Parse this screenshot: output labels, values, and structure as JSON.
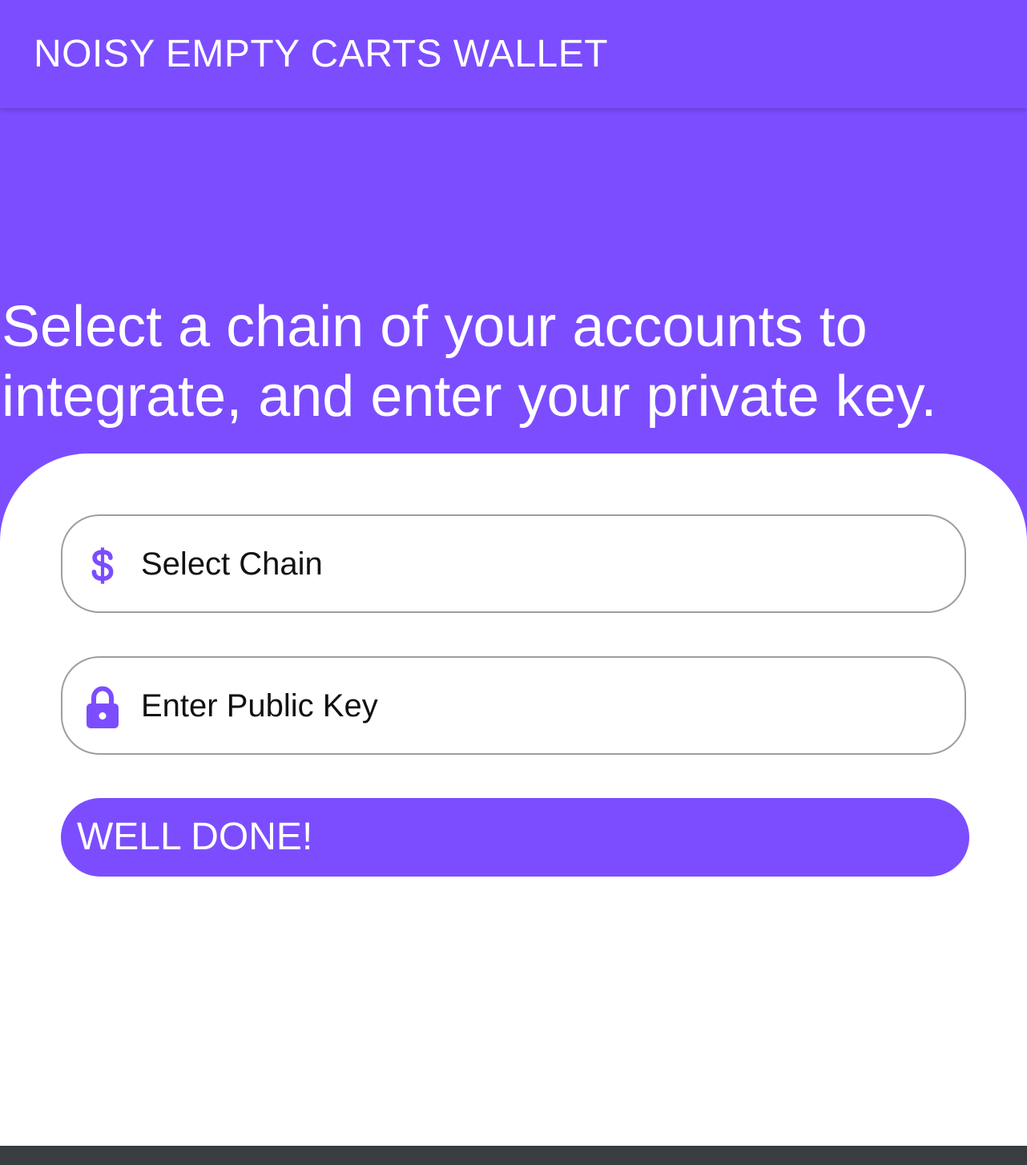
{
  "appbar": {
    "title": "NOISY EMPTY CARTS WALLET"
  },
  "headline": "Select a chain of your accounts to integrate, and enter your private key.",
  "form": {
    "chain_field": {
      "icon": "dollar-icon",
      "placeholder": "Select Chain"
    },
    "key_field": {
      "icon": "lock-icon",
      "placeholder": "Enter Public Key"
    },
    "submit_label": "WELL DONE!"
  },
  "colors": {
    "accent": "#7c4dff",
    "surface": "#ffffff",
    "border": "#9e9e9e"
  }
}
